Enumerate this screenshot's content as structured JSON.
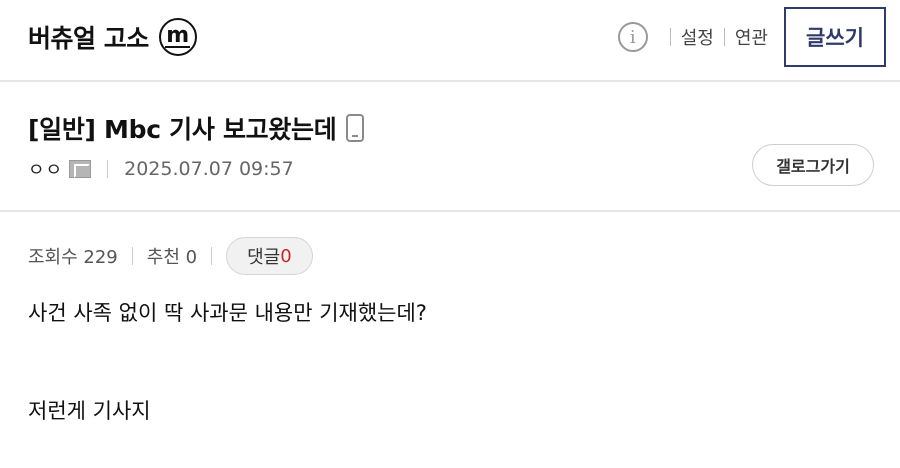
{
  "header": {
    "gallery_name": "버츄얼 고소",
    "badge_letter": "m",
    "links": [
      "설정",
      "연관"
    ],
    "write_label": "글쓰기"
  },
  "post": {
    "title": "[일반] Mbc 기사 보고왔는데",
    "author": "ㅇㅇ",
    "datetime": "2025.07.07 09:57",
    "gallery_button": "갤로그가기",
    "views": "조회수 229",
    "recommend": "추천 0",
    "comment_label": "댓글",
    "comment_count": "0",
    "body": [
      "사건 사족 없이 딱 사과문 내용만 기재했는데?",
      "저런게 기사지"
    ]
  },
  "icons": {
    "info": "info-icon",
    "mobile": "mobile-icon",
    "member": "member-icon"
  },
  "colors": {
    "accent": "#2f3c6b",
    "comment_count": "#c62828"
  }
}
